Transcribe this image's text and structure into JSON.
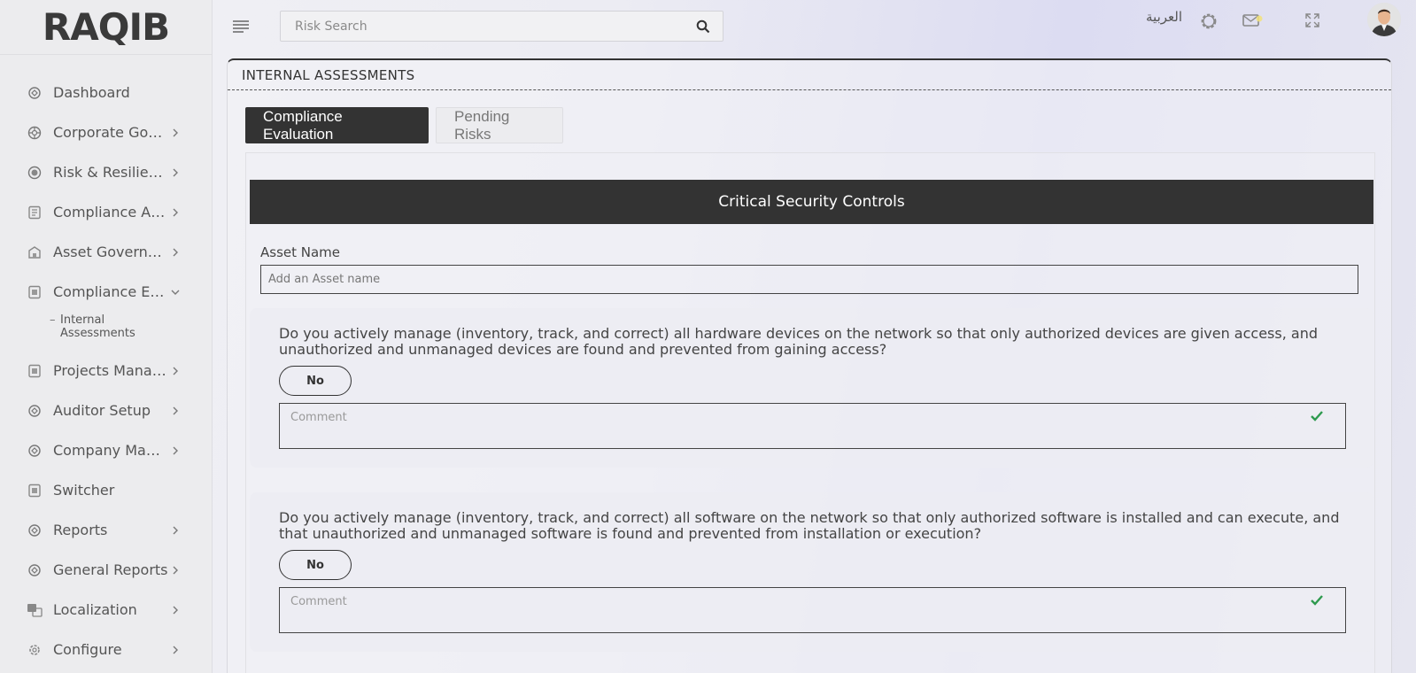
{
  "app": {
    "logo_text": "RAQIB"
  },
  "header": {
    "search_placeholder": "Risk Search",
    "language_label": "العربية",
    "icons": [
      "menu-icon",
      "search-icon",
      "settings-icon",
      "mail-icon",
      "fullscreen-icon"
    ]
  },
  "sidebar": {
    "items": [
      {
        "label": "Dashboard",
        "icon": "dashboard-icon",
        "has_children": false
      },
      {
        "label": "Corporate Governance",
        "icon": "governance-icon",
        "has_children": true
      },
      {
        "label": "Risk & Resilience",
        "icon": "risk-icon",
        "has_children": true
      },
      {
        "label": "Compliance Assessment",
        "icon": "compliance-icon",
        "has_children": true
      },
      {
        "label": "Asset Governance",
        "icon": "asset-icon",
        "has_children": true
      },
      {
        "label": "Compliance Evaluation",
        "icon": "evaluation-icon",
        "has_children": true,
        "expanded": true
      },
      {
        "label": "Projects Management",
        "icon": "projects-icon",
        "has_children": true
      },
      {
        "label": "Auditor Setup",
        "icon": "auditor-icon",
        "has_children": true
      },
      {
        "label": "Company Management",
        "icon": "company-icon",
        "has_children": true
      },
      {
        "label": "Switcher",
        "icon": "switcher-icon",
        "has_children": false
      },
      {
        "label": "Reports",
        "icon": "reports-icon",
        "has_children": true
      },
      {
        "label": "General Reports",
        "icon": "general-reports-icon",
        "has_children": true
      },
      {
        "label": "Localization",
        "icon": "localization-icon",
        "has_children": true
      },
      {
        "label": "Configure",
        "icon": "configure-icon",
        "has_children": true
      }
    ],
    "sub_item": {
      "label_line1": "Internal",
      "label_line2": "Assessments"
    }
  },
  "main": {
    "panel_title": "INTERNAL ASSESSMENTS",
    "tabs": [
      {
        "label": "Compliance Evaluation",
        "active": true
      },
      {
        "label": "Pending Risks",
        "active": false
      }
    ],
    "section_title": "Critical Security Controls",
    "asset_label": "Asset Name",
    "asset_placeholder": "Add an Asset name",
    "questions": [
      {
        "text": "Do you actively manage (inventory, track, and correct) all hardware devices on the network so that only authorized devices are given access, and unauthorized and unmanaged devices are found and prevented from gaining access?",
        "answer": "No",
        "comment_placeholder": "Comment"
      },
      {
        "text": "Do you actively manage (inventory, track, and correct) all software on the network so that only authorized software is installed and can execute, and that unauthorized and unmanaged software is found and prevented from installation or execution?",
        "answer": "No",
        "comment_placeholder": "Comment"
      }
    ]
  },
  "colors": {
    "dark": "#333333",
    "check_green": "#2e9a4e"
  }
}
